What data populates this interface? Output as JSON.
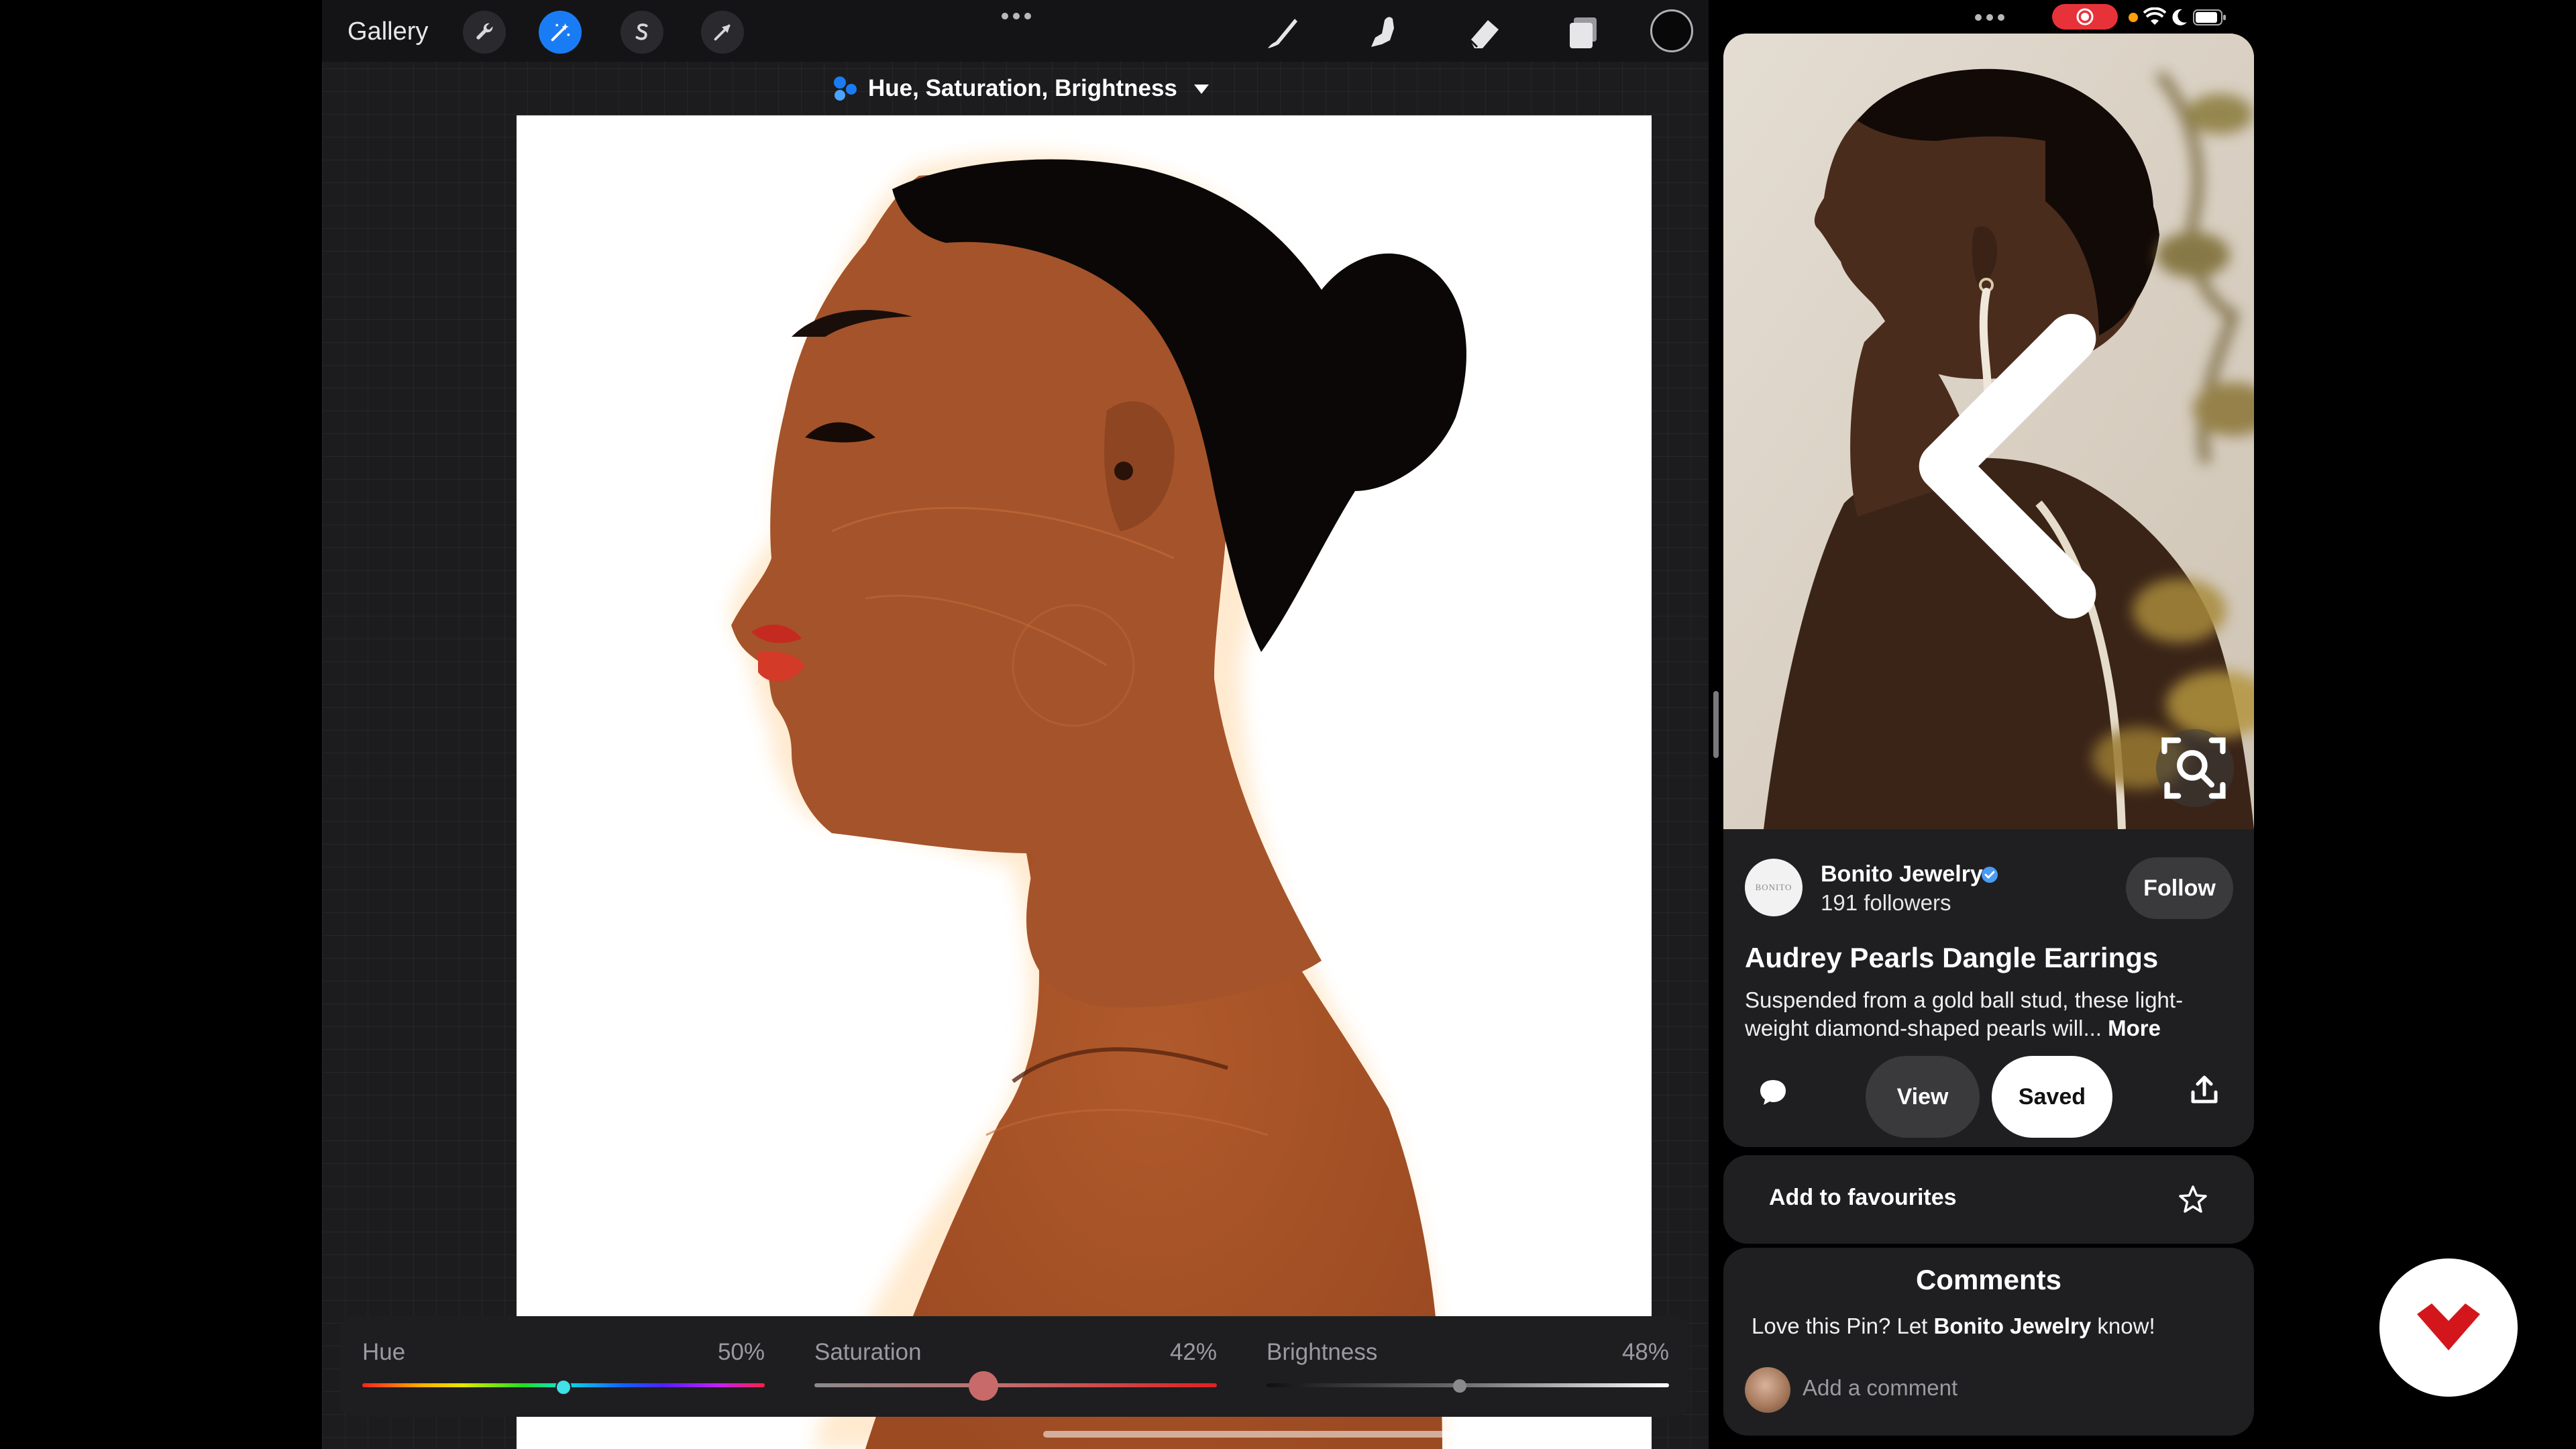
{
  "procreate": {
    "gallery_label": "Gallery",
    "tools_left": [
      {
        "name": "wrench-icon",
        "active": false
      },
      {
        "name": "adjustments-magic-icon",
        "active": true
      },
      {
        "name": "selection-s-icon",
        "active": false
      },
      {
        "name": "transform-arrow-icon",
        "active": false
      }
    ],
    "tools_right": [
      "brush-icon",
      "smudge-icon",
      "eraser-icon",
      "layers-icon"
    ],
    "current_color": "#080808",
    "adjustment_title": "Hue, Saturation, Brightness",
    "sliders": {
      "hue": {
        "label": "Hue",
        "value": "50%",
        "fraction": 0.5
      },
      "saturation": {
        "label": "Saturation",
        "value": "42%",
        "fraction": 0.42
      },
      "brightness": {
        "label": "Brightness",
        "value": "48%",
        "fraction": 0.48
      }
    },
    "accent_color": "#1a7cf5"
  },
  "pinterest": {
    "status": {
      "recording": true
    },
    "creator": {
      "name": "Bonito Jewelry",
      "avatar_text": "BONITO",
      "verified": true,
      "followers": "191 followers"
    },
    "follow_label": "Follow",
    "pin_title": "Audrey Pearls Dangle Earrings",
    "description": "Suspended from a gold ball stud, these light-weight diamond-shaped pearls will...",
    "more_label": "More",
    "view_label": "View",
    "saved_label": "Saved",
    "favourites_label": "Add to favourites",
    "comments": {
      "title": "Comments",
      "prompt_prefix": "Love this Pin? Let ",
      "prompt_name": "Bonito Jewelry",
      "prompt_suffix": " know!",
      "placeholder": "Add a comment"
    }
  },
  "logo_badge": {
    "color": "#d3161b"
  }
}
